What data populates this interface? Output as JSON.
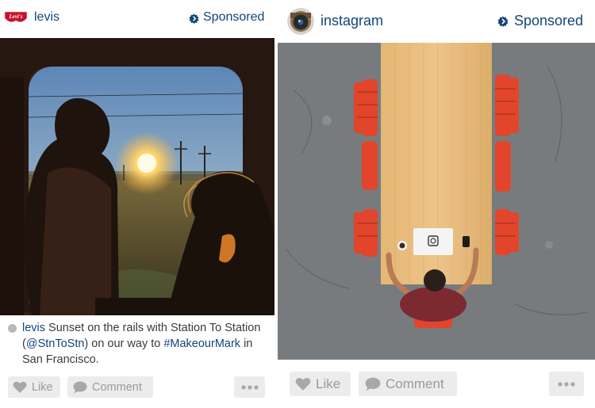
{
  "posts": [
    {
      "username": "levis",
      "sponsored_label": "Sponsored",
      "logo_text": "Levi's",
      "caption": {
        "user": "levis",
        "text_1": " Sunset on the rails with Station To Station (",
        "mention": "@StnToStn",
        "text_2": ") on our way to ",
        "hashtag": "#MakeourMark",
        "text_3": " in San Francisco."
      },
      "like_label": "Like",
      "comment_label": "Comment"
    },
    {
      "username": "instagram",
      "sponsored_label": "Sponsored",
      "like_label": "Like",
      "comment_label": "Comment"
    }
  ],
  "colors": {
    "link_blue": "#12457a",
    "button_bg": "#ececec",
    "button_text": "#9a9a9a",
    "levis_red": "#c8102e",
    "chair_red": "#e2452b"
  },
  "icons": [
    "levis-logo-icon",
    "sponsored-badge-icon",
    "instagram-camera-icon",
    "heart-icon",
    "comment-bubble-icon",
    "more-dots-icon"
  ]
}
